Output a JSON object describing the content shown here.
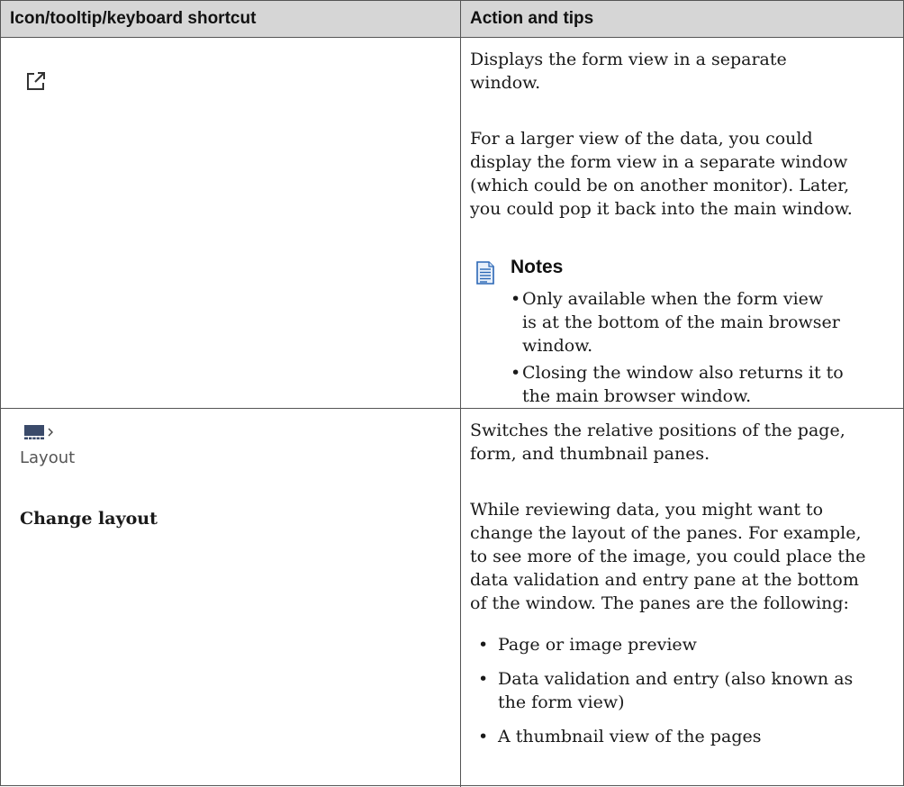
{
  "table": {
    "headers": {
      "col1": "Icon/tooltip/keyboard shortcut",
      "col2": "Action and tips"
    },
    "rows": [
      {
        "icon": "popout-window-icon",
        "action": {
          "summary_lines": [
            "Displays the form view in a separate",
            "window."
          ],
          "detail_lines": [
            "For a larger view of the data, you could",
            "display the form view in a separate window",
            "(which could be on another monitor). Later,",
            "you could pop it back into the main window."
          ],
          "notes": {
            "icon": "document-note-icon",
            "title": "Notes",
            "items": [
              [
                "Only available when the form view",
                "is at the bottom of the main browser",
                "window."
              ],
              [
                "Closing the window also returns it to",
                "the main browser window."
              ]
            ]
          }
        }
      },
      {
        "icon": "layout-icon",
        "icon_label": "Layout",
        "tooltip": "Change layout",
        "action": {
          "summary_lines": [
            "Switches the relative positions of the page,",
            "form, and thumbnail panes."
          ],
          "detail_lines": [
            "While reviewing data, you might want to",
            "change the layout of the panes. For example,",
            "to see more of the image, you could place the",
            "data validation and entry pane at the bottom",
            "of the window. The panes are the following:"
          ],
          "list": [
            [
              "Page or image preview"
            ],
            [
              "Data validation and entry (also known as",
              "the form view)"
            ],
            [
              "A thumbnail view of the pages"
            ]
          ]
        }
      }
    ]
  }
}
